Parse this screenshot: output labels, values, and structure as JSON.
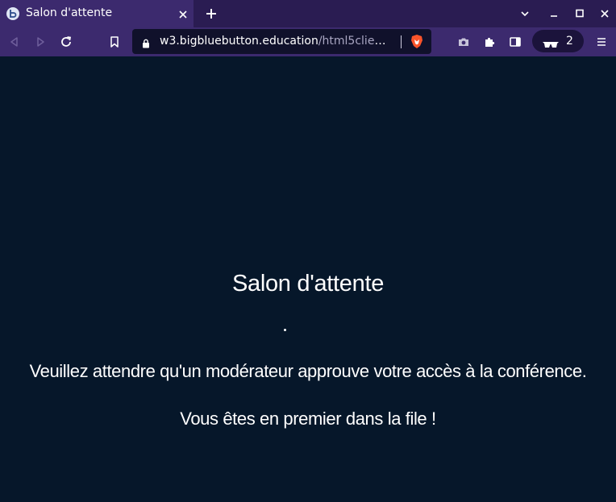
{
  "browser": {
    "tab": {
      "title": "Salon d'attente",
      "favicon": "bigbluebutton-icon"
    },
    "url": {
      "host": "w3.bigbluebutton.education",
      "path": "/html5client/g..."
    },
    "shields_count": "2",
    "icons": [
      "back-icon",
      "forward-icon",
      "reload-icon",
      "bookmark-icon",
      "lock-icon",
      "brave-shield-icon",
      "camera-icon",
      "extensions-icon",
      "sidebar-icon",
      "private-glasses-icon",
      "menu-icon",
      "chevron-down-icon",
      "minimize-icon",
      "maximize-icon",
      "close-icon"
    ]
  },
  "page": {
    "heading": "Salon d'attente",
    "message": "Veuillez attendre qu'un modérateur approuve votre accès à la conférence.",
    "queue_position": "Vous êtes en premier dans la file !"
  },
  "colors": {
    "tabbar": "#2a1c52",
    "toolbar": "#3c2a6e",
    "urlbar": "#10112b",
    "page_background": "#06172a",
    "text": "#ffffff"
  }
}
